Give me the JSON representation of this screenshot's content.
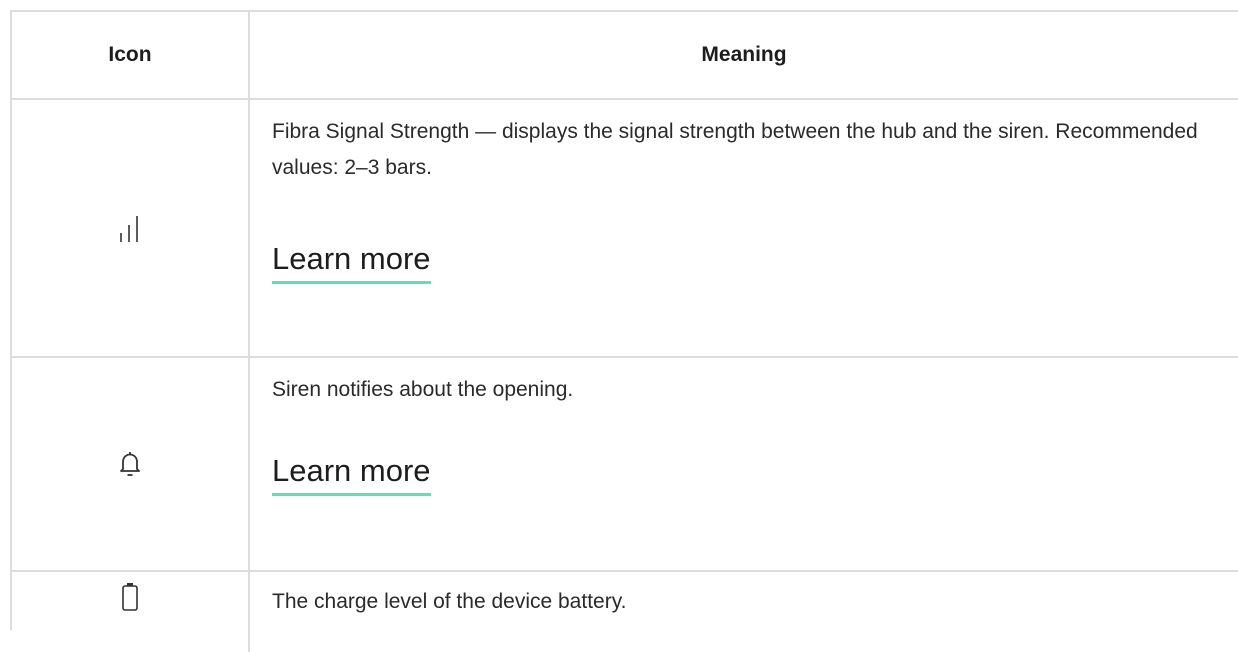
{
  "table": {
    "headers": {
      "icon": "Icon",
      "meaning": "Meaning"
    },
    "rows": [
      {
        "icon": "signal-strength-icon",
        "text": "Fibra Signal Strength — displays the signal strength between the hub and the siren. Recommended values: 2–3 bars.",
        "link": "Learn more"
      },
      {
        "icon": "bell-icon",
        "text": "Siren notifies about the opening.",
        "link": "Learn more"
      },
      {
        "icon": "battery-icon",
        "text": "The charge level of the device battery."
      }
    ]
  },
  "colors": {
    "border": "#dcdcdc",
    "link_underline": "#5fe0b0",
    "text": "#1d1d1d"
  }
}
